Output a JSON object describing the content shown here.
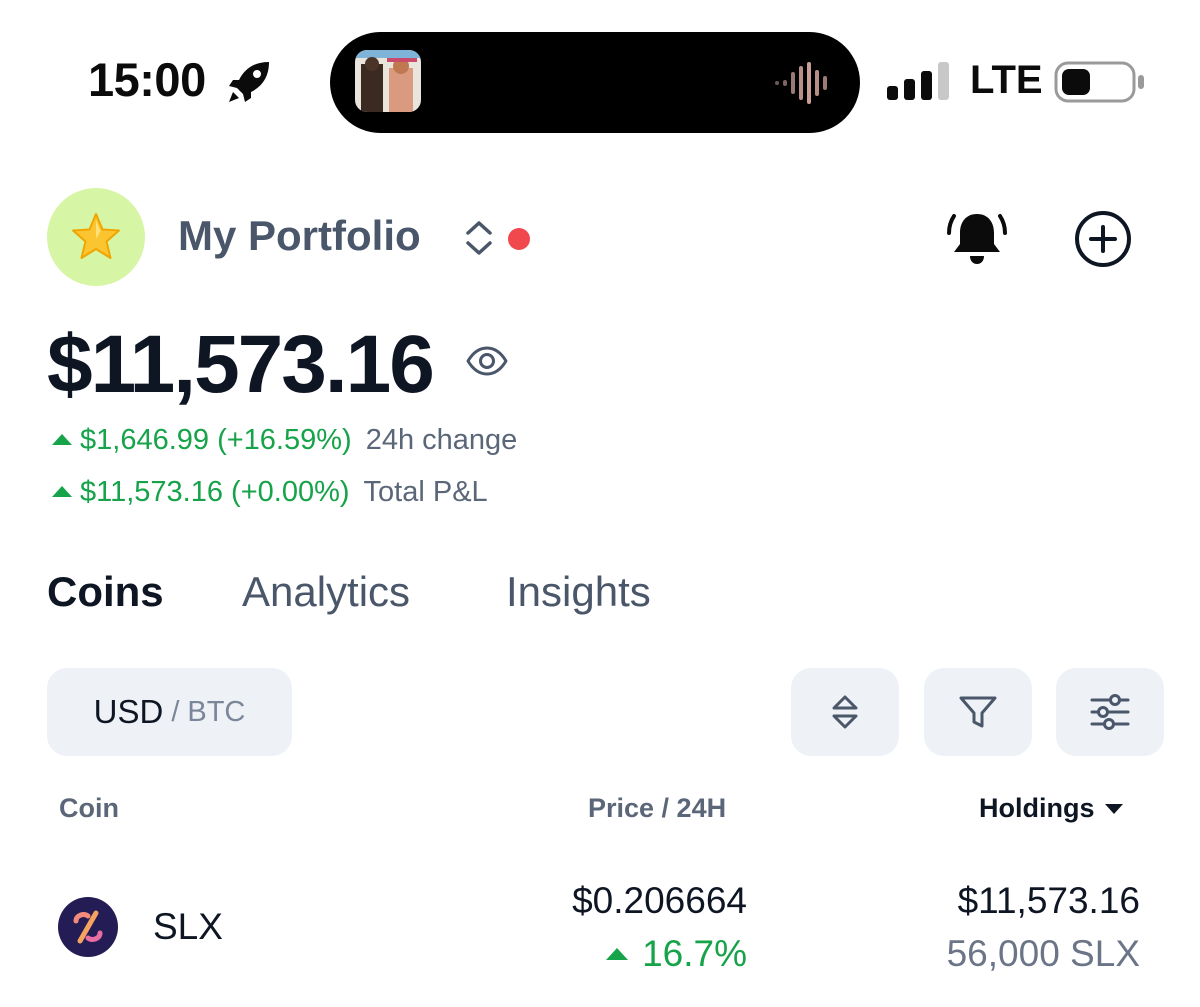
{
  "status_bar": {
    "time": "15:00",
    "network": "LTE",
    "signal_bars_filled": 3,
    "signal_bars_total": 4
  },
  "header": {
    "avatar_icon": "star-icon",
    "portfolio_name": "My Portfolio",
    "accent_color": "#d6f5a5",
    "notification_dot_color": "#f0484d"
  },
  "balance": {
    "total": "$11,573.16",
    "change_24h_value": "$1,646.99 (+16.59%)",
    "change_24h_label": "24h change",
    "pnl_value": "$11,573.16 (+0.00%)",
    "pnl_label": "Total P&L",
    "positive_color": "#16a34a"
  },
  "tabs": [
    {
      "label": "Coins",
      "active": true
    },
    {
      "label": "Analytics",
      "active": false
    },
    {
      "label": "Insights",
      "active": false
    }
  ],
  "toolbar": {
    "currency_primary": "USD",
    "currency_separator": "/",
    "currency_secondary": "BTC",
    "sort_icon": "sort-icon",
    "filter_icon": "filter-icon",
    "settings_icon": "sliders-icon"
  },
  "table": {
    "headers": {
      "coin": "Coin",
      "price": "Price / 24H",
      "holdings": "Holdings"
    },
    "rows": [
      {
        "symbol": "SLX",
        "price": "$0.206664",
        "change_24h": "16.7%",
        "holdings_value": "$11,573.16",
        "holdings_qty": "56,000 SLX"
      }
    ]
  }
}
